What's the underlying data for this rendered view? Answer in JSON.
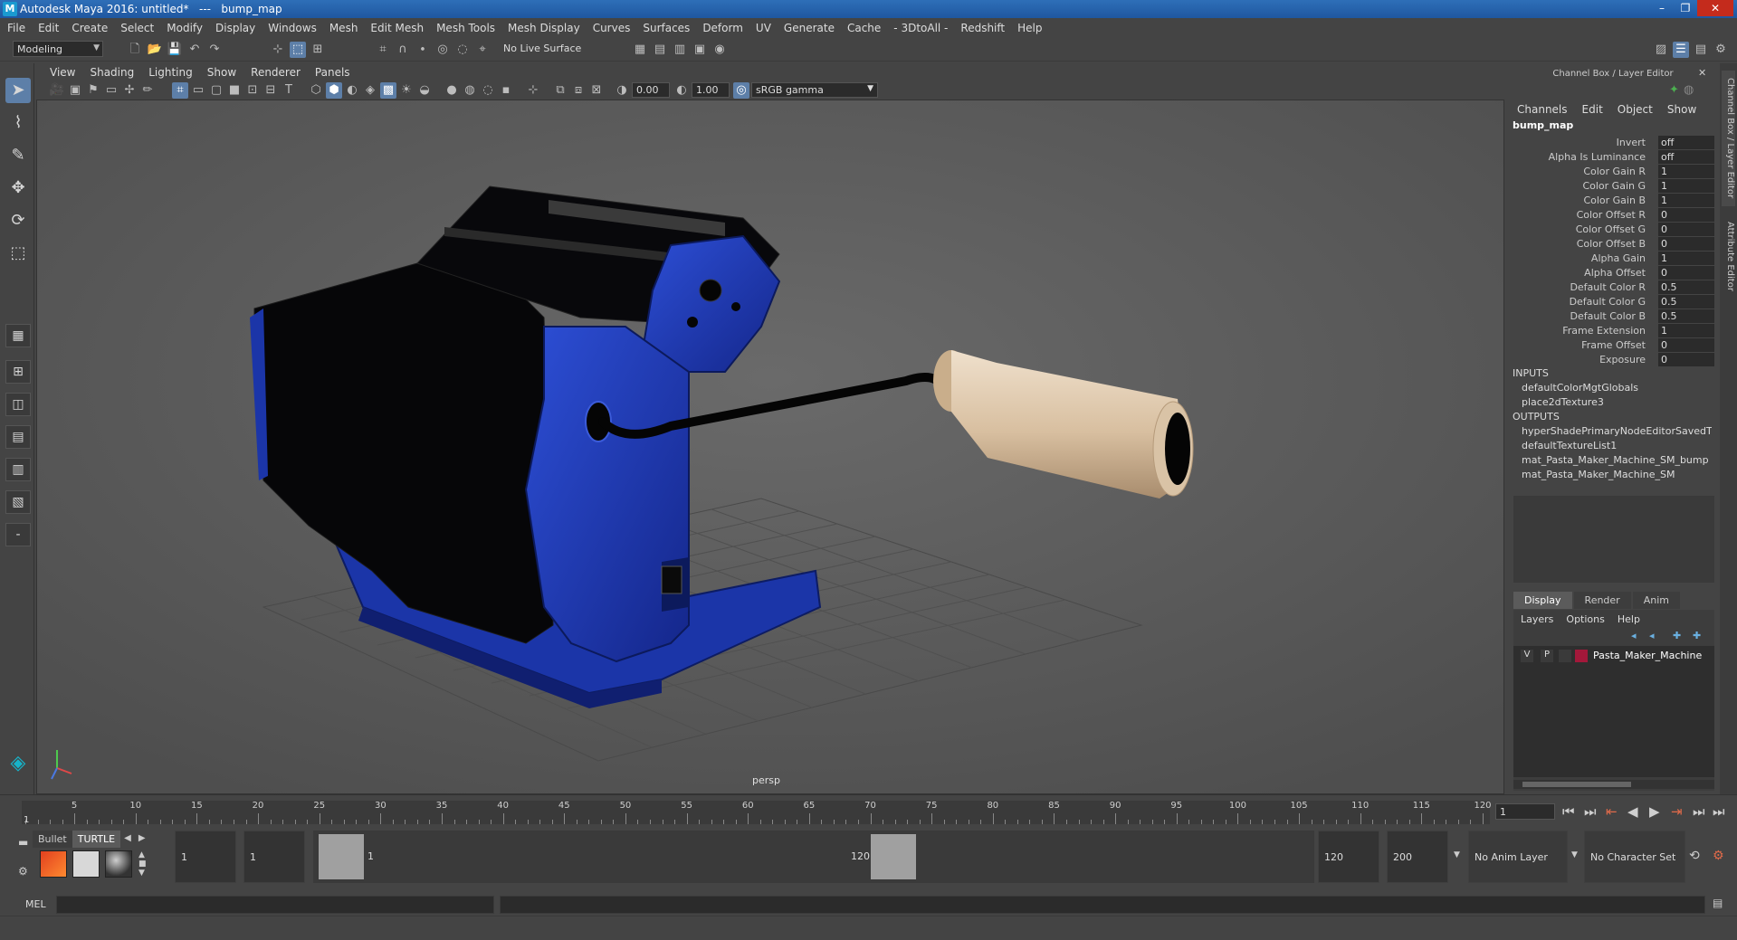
{
  "window": {
    "title": "Autodesk Maya 2016: untitled*   ---   bump_map",
    "minimize": "–",
    "restore": "❐",
    "close": "✕"
  },
  "menubar": [
    "File",
    "Edit",
    "Create",
    "Select",
    "Modify",
    "Display",
    "Windows",
    "Mesh",
    "Edit Mesh",
    "Mesh Tools",
    "Mesh Display",
    "Curves",
    "Surfaces",
    "Deform",
    "UV",
    "Generate",
    "Cache",
    "- 3DtoAll -",
    "Redshift",
    "Help"
  ],
  "shelf": {
    "mode": "Modeling",
    "live_surface": "No Live Surface"
  },
  "viewport": {
    "menu": [
      "View",
      "Shading",
      "Lighting",
      "Show",
      "Renderer",
      "Panels"
    ],
    "exposure": "0.00",
    "gamma": "1.00",
    "color_space": "sRGB gamma",
    "camera_label": "persp"
  },
  "channel_box": {
    "header": "Channel Box / Layer Editor",
    "menu": [
      "Channels",
      "Edit",
      "Object",
      "Show"
    ],
    "node_name": "bump_map",
    "attributes": [
      {
        "label": "Invert",
        "value": "off"
      },
      {
        "label": "Alpha Is Luminance",
        "value": "off"
      },
      {
        "label": "Color Gain R",
        "value": "1"
      },
      {
        "label": "Color Gain G",
        "value": "1"
      },
      {
        "label": "Color Gain B",
        "value": "1"
      },
      {
        "label": "Color Offset R",
        "value": "0"
      },
      {
        "label": "Color Offset G",
        "value": "0"
      },
      {
        "label": "Color Offset B",
        "value": "0"
      },
      {
        "label": "Alpha Gain",
        "value": "1"
      },
      {
        "label": "Alpha Offset",
        "value": "0"
      },
      {
        "label": "Default Color R",
        "value": "0.5"
      },
      {
        "label": "Default Color G",
        "value": "0.5"
      },
      {
        "label": "Default Color B",
        "value": "0.5"
      },
      {
        "label": "Frame Extension",
        "value": "1"
      },
      {
        "label": "Frame Offset",
        "value": "0"
      },
      {
        "label": "Exposure",
        "value": "0"
      }
    ],
    "inputs_label": "INPUTS",
    "inputs": [
      "defaultColorMgtGlobals",
      "place2dTexture3"
    ],
    "outputs_label": "OUTPUTS",
    "outputs": [
      "hyperShadePrimaryNodeEditorSavedT...",
      "defaultTextureList1",
      "mat_Pasta_Maker_Machine_SM_bump",
      "mat_Pasta_Maker_Machine_SM"
    ]
  },
  "layer_editor": {
    "tabs": [
      "Display",
      "Render",
      "Anim"
    ],
    "menu": [
      "Layers",
      "Options",
      "Help"
    ],
    "layer": {
      "v": "V",
      "p": "P",
      "name": "Pasta_Maker_Machine",
      "color": "#a3183a"
    }
  },
  "side_tabs": [
    "Channel Box / Layer Editor",
    "Attribute Editor"
  ],
  "timeline": {
    "ticks": [
      "5",
      "10",
      "15",
      "20",
      "25",
      "30",
      "35",
      "40",
      "45",
      "50",
      "55",
      "60",
      "65",
      "70",
      "75",
      "80",
      "85",
      "90",
      "95",
      "100",
      "105",
      "110",
      "115",
      "120"
    ],
    "start_tick": "1",
    "current_frame": "1"
  },
  "range": {
    "shelf_tabs": [
      "Bullet",
      "TURTLE"
    ],
    "start_min": "1",
    "start": "1",
    "slider_start": "1",
    "slider_end": "120",
    "end": "120",
    "end_max": "200",
    "anim_layer": "No Anim Layer",
    "character_set": "No Character Set"
  },
  "cmdline": {
    "label": "MEL"
  },
  "colors": {
    "machine_blue": "#1b35a8",
    "handle_wood": "#d8c0a2",
    "accent": "#5d7fa8"
  }
}
